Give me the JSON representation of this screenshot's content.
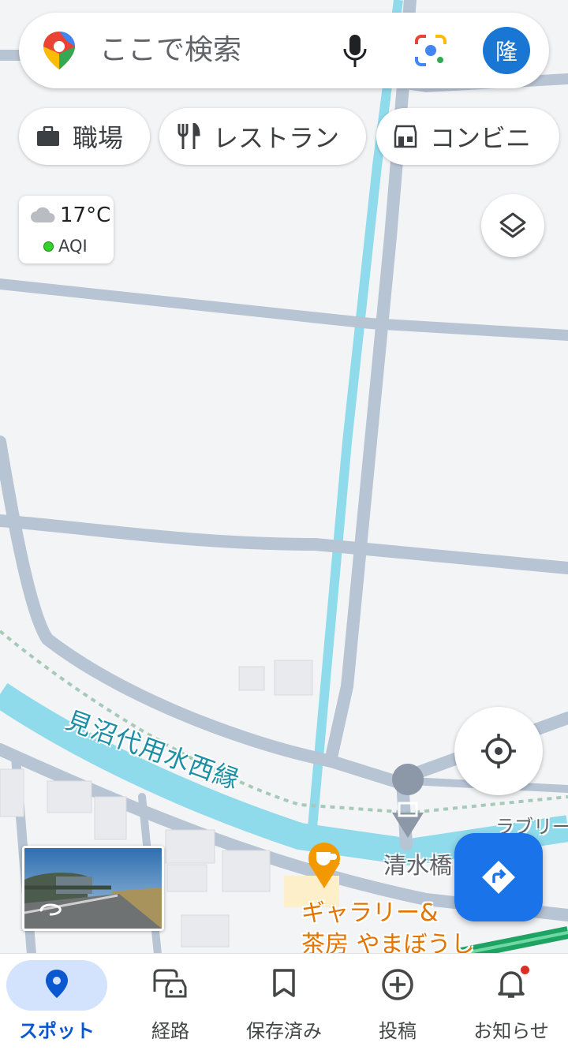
{
  "search": {
    "placeholder": "ここで検索",
    "avatar_initial": "隆"
  },
  "chips": [
    {
      "label": "職場",
      "icon": "briefcase-icon"
    },
    {
      "label": "レストラン",
      "icon": "restaurant-icon"
    },
    {
      "label": "コンビニ",
      "icon": "convenience-store-icon"
    }
  ],
  "weather": {
    "temp": "17°C",
    "aqi": "AQI",
    "aqi_color": "#34d12b"
  },
  "map": {
    "canal_label": "見沼代用水西縁",
    "bridge_label": "清水橋",
    "partial_label": "ラブリー",
    "cafe_label_1": "ギャラリー&",
    "cafe_label_2": "茶房 やまぼうし"
  },
  "nav": [
    {
      "label": "スポット",
      "icon": "location-pin-icon",
      "active": true
    },
    {
      "label": "経路",
      "icon": "commute-icon",
      "active": false
    },
    {
      "label": "保存済み",
      "icon": "bookmark-icon",
      "active": false
    },
    {
      "label": "投稿",
      "icon": "add-circle-icon",
      "active": false
    },
    {
      "label": "お知らせ",
      "icon": "bell-icon",
      "active": false
    }
  ],
  "colors": {
    "accent": "#1a73e8",
    "active_nav": "#0b57d0",
    "water": "#8fdaeb",
    "road": "#b7c4d3",
    "cafe": "#e37400"
  }
}
